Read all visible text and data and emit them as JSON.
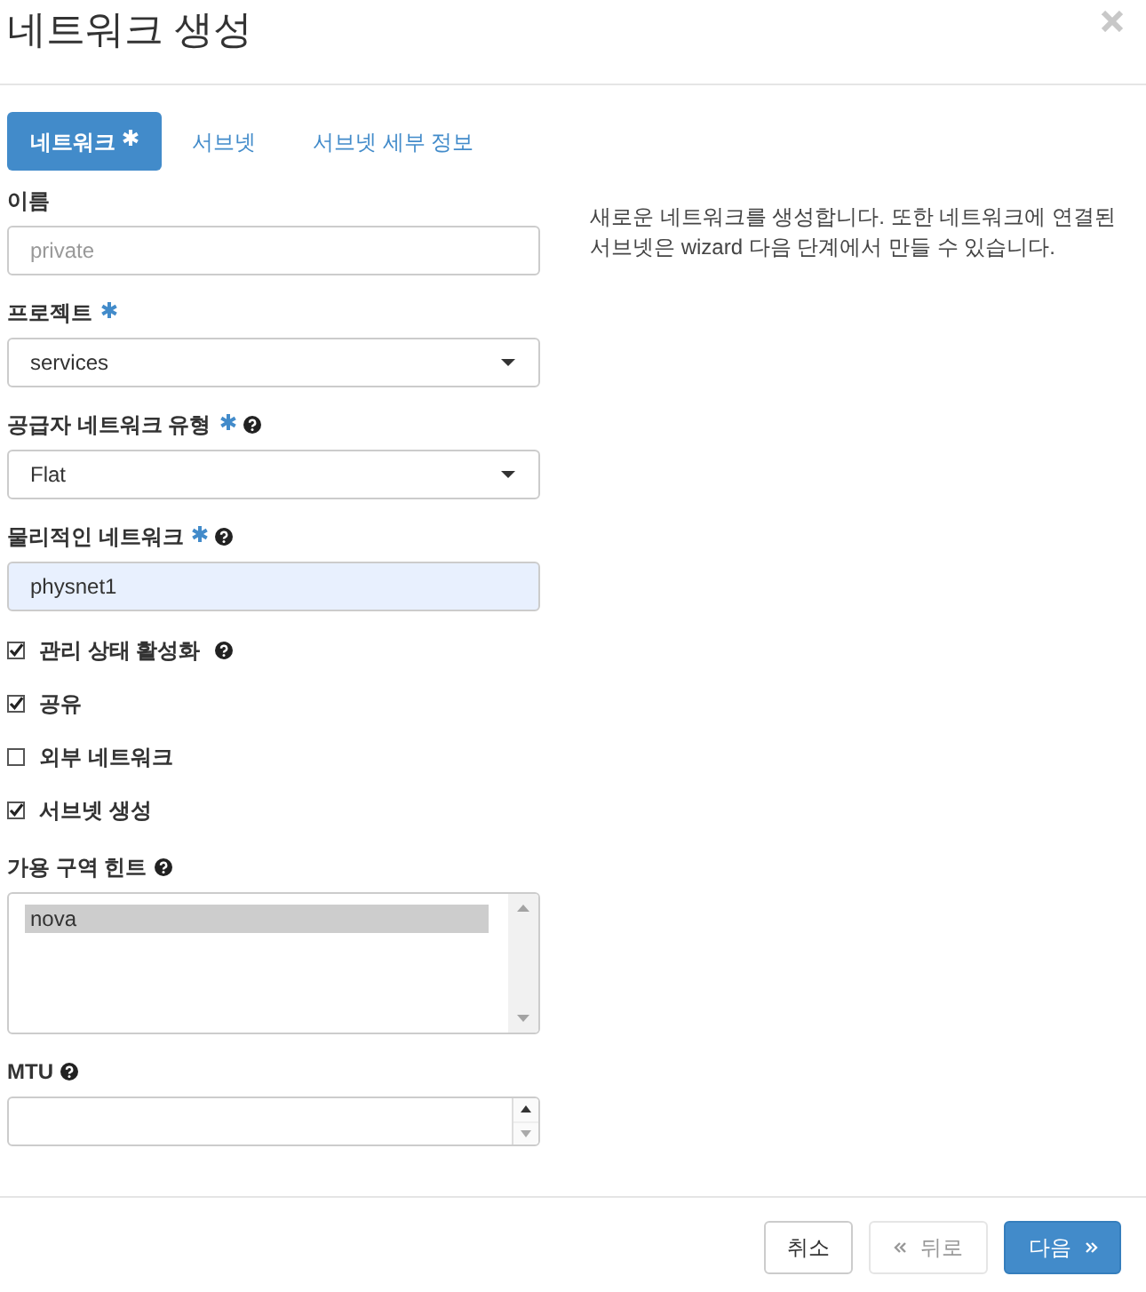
{
  "dialog": {
    "title": "네트워크 생성"
  },
  "tabs": [
    {
      "label": "네트워크",
      "required": true,
      "selected": true
    },
    {
      "label": "서브넷",
      "required": false,
      "selected": false
    },
    {
      "label": "서브넷 세부 정보",
      "required": false,
      "selected": false
    }
  ],
  "fields": [
    {
      "kind": "text",
      "label": "이름",
      "required": false,
      "help": false,
      "placeholder": "private",
      "autofilled": false
    },
    {
      "kind": "select",
      "label": "프로젝트",
      "required": true,
      "help": false,
      "value": "services"
    },
    {
      "kind": "select",
      "label": "공급자 네트워크 유형",
      "required": true,
      "help": true,
      "value": "Flat"
    },
    {
      "kind": "text",
      "label": "물리적인 네트워크",
      "required": true,
      "help": true,
      "value": "physnet1",
      "autofilled": true
    },
    {
      "kind": "checkbox",
      "label": "관리 상태 활성화",
      "help": true,
      "checked": true
    },
    {
      "kind": "checkbox",
      "label": "공유",
      "help": false,
      "checked": true
    },
    {
      "kind": "checkbox",
      "label": "외부 네트워크",
      "help": false,
      "checked": false
    },
    {
      "kind": "checkbox",
      "label": "서브넷 생성",
      "help": false,
      "checked": true
    },
    {
      "kind": "listbox",
      "label": "가용 구역 힌트",
      "required": false,
      "help": true,
      "options": [
        {
          "label": "nova",
          "selected": true
        }
      ]
    },
    {
      "kind": "number",
      "label": "MTU",
      "required": false,
      "help": true
    }
  ],
  "description": "새로운 네트워크를 생성합니다. 또한 네트워크에 연결된 서브넷은 wizard 다음 단계에서 만들 수 있습니다.",
  "footer": {
    "buttons": [
      {
        "kind": "cancel",
        "label": "취소",
        "disabled": false
      },
      {
        "kind": "back",
        "label": "뒤로",
        "disabled": true
      },
      {
        "kind": "next",
        "label": "다음",
        "disabled": false
      }
    ]
  }
}
